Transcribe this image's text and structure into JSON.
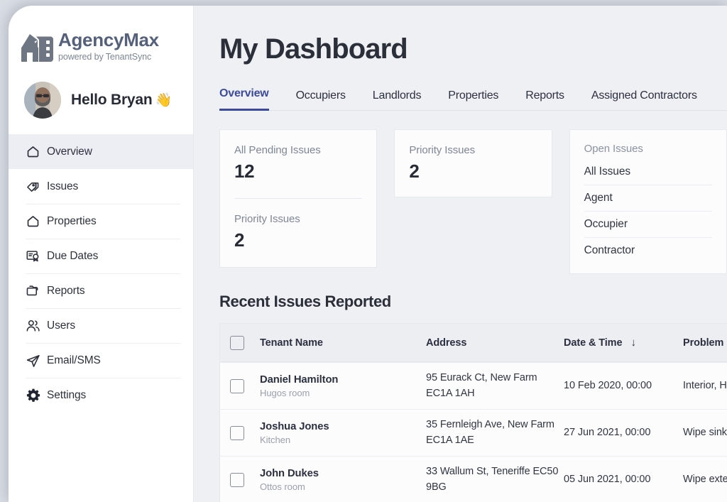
{
  "brand": {
    "name": "AgencyMax",
    "tagline": "powered by TenantSync",
    "logo_icon": "house-building-icon"
  },
  "user": {
    "greeting": "Hello Bryan",
    "wave_emoji": "👋",
    "avatar_icon": "user-avatar-photo"
  },
  "sidebar": {
    "items": [
      {
        "label": "Overview",
        "icon": "home-icon",
        "active": true
      },
      {
        "label": "Issues",
        "icon": "tags-icon",
        "active": false
      },
      {
        "label": "Properties",
        "icon": "home-icon",
        "active": false
      },
      {
        "label": "Due Dates",
        "icon": "certificate-icon",
        "active": false
      },
      {
        "label": "Reports",
        "icon": "folder-icon",
        "active": false
      },
      {
        "label": "Users",
        "icon": "users-icon",
        "active": false
      },
      {
        "label": "Email/SMS",
        "icon": "send-icon",
        "active": false
      },
      {
        "label": "Settings",
        "icon": "gear-icon",
        "active": false
      }
    ]
  },
  "main": {
    "page_title": "My Dashboard",
    "tabs": [
      {
        "label": "Overview",
        "active": true
      },
      {
        "label": "Occupiers",
        "active": false
      },
      {
        "label": "Landlords",
        "active": false
      },
      {
        "label": "Properties",
        "active": false
      },
      {
        "label": "Reports",
        "active": false
      },
      {
        "label": "Assigned Contractors",
        "active": false
      }
    ],
    "cards": {
      "all_pending": {
        "label": "All Pending Issues",
        "value": "12"
      },
      "priority_in_card": {
        "label": "Priority Issues",
        "value": "2"
      },
      "priority": {
        "label": "Priority Issues",
        "value": "2"
      },
      "open_issues": {
        "label": "Open Issues",
        "items": [
          "All Issues",
          "Agent",
          "Occupier",
          "Contractor"
        ]
      }
    },
    "table": {
      "title": "Recent Issues Reported",
      "columns": {
        "tenant_name": "Tenant Name",
        "address": "Address",
        "date_time": "Date & Time",
        "problem": "Problem"
      },
      "sort_indicator": "↓",
      "rows": [
        {
          "name": "Daniel Hamilton",
          "room": "Hugos room",
          "address": "95 Eurack Ct, New Farm EC1A 1AH",
          "date": "10 Feb 2020, 00:00",
          "problem": "Interior, Hob"
        },
        {
          "name": "Joshua Jones",
          "room": "Kitchen",
          "address": "35 Fernleigh Ave, New Farm EC1A 1AE",
          "date": "27 Jun 2021, 00:00",
          "problem": "Wipe sink &"
        },
        {
          "name": "John Dukes",
          "room": "Ottos room",
          "address": "33 Wallum St, Teneriffe EC50 9BG",
          "date": "05 Jun 2021, 00:00",
          "problem": "Wipe exterior refrigerator"
        }
      ]
    }
  },
  "colors": {
    "accent": "#3b4a9c",
    "page_bg": "#eef0f4",
    "sidebar_bg": "#ffffff",
    "card_bg": "#fcfcfd",
    "text_dark": "#2b3040",
    "text_muted": "#8a92a0",
    "logo_gray": "#6e7683"
  }
}
